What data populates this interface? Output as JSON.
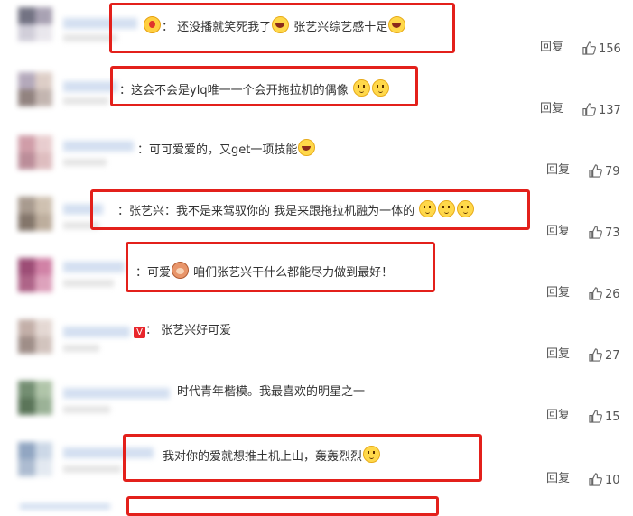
{
  "reply_label": "回复",
  "highlight_color": "#e3201b",
  "comments": [
    {
      "text": "还没播就笑死我了",
      "text_b": "张艺兴综艺感十足",
      "emojis": [
        "star-face-icon",
        "laugh-emoji-icon",
        "laugh-emoji-icon"
      ],
      "likes": "156"
    },
    {
      "text": "这会不会是ylq唯一一个会开拖拉机的偶像",
      "emojis": [
        "cat-face-icon",
        "cat-face-icon"
      ],
      "likes": "137"
    },
    {
      "text": "可可爱爱的，又get一项技能",
      "emojis": [
        "laugh-emoji-icon"
      ],
      "likes": "79"
    },
    {
      "text": "张艺兴：我不是来驾驭你的 我是来跟拖拉机融为一体的",
      "emojis": [
        "cat-face-icon",
        "cat-face-icon",
        "cat-face-icon"
      ],
      "likes": "73"
    },
    {
      "text_pre": "可爱",
      "text": "咱们张艺兴干什么都能尽力做到最好！",
      "emojis": [
        "monkey-face-icon"
      ],
      "likes": "26"
    },
    {
      "text": "张艺兴好可爱",
      "badge": "V",
      "likes": "27"
    },
    {
      "text": "时代青年楷模。我最喜欢的明星之一",
      "likes": "15"
    },
    {
      "text": "我对你的爱就想推土机上山，轰轰烈烈",
      "emojis": [
        "cat-face-icon"
      ],
      "likes": "10"
    }
  ]
}
